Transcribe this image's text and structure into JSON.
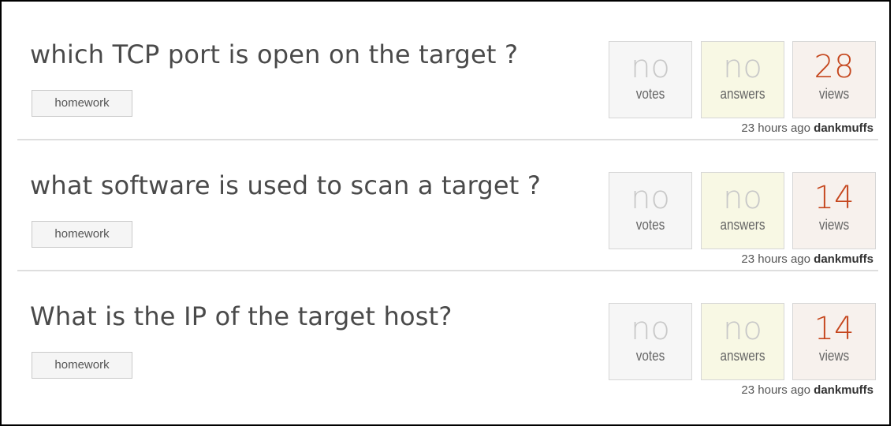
{
  "questions": [
    {
      "title": "which TCP port is open on the target ?",
      "tag": "homework",
      "votes": {
        "value": "no",
        "label": "votes"
      },
      "answers": {
        "value": "no",
        "label": "answers"
      },
      "views": {
        "value": "28",
        "label": "views"
      },
      "time": "23 hours ago",
      "user": "dankmuffs"
    },
    {
      "title": "what software is used to scan a target ?",
      "tag": "homework",
      "votes": {
        "value": "no",
        "label": "votes"
      },
      "answers": {
        "value": "no",
        "label": "answers"
      },
      "views": {
        "value": "14",
        "label": "views"
      },
      "time": "23 hours ago",
      "user": "dankmuffs"
    },
    {
      "title": "What is the IP of the target host?",
      "tag": "homework",
      "votes": {
        "value": "no",
        "label": "votes"
      },
      "answers": {
        "value": "no",
        "label": "answers"
      },
      "views": {
        "value": "14",
        "label": "views"
      },
      "time": "23 hours ago",
      "user": "dankmuffs"
    }
  ],
  "colors": {
    "views_accent": "#c5461d",
    "title": "#4a4a4a",
    "answers_bg": "#f8f8e4",
    "views_bg": "#f7f1ed"
  }
}
